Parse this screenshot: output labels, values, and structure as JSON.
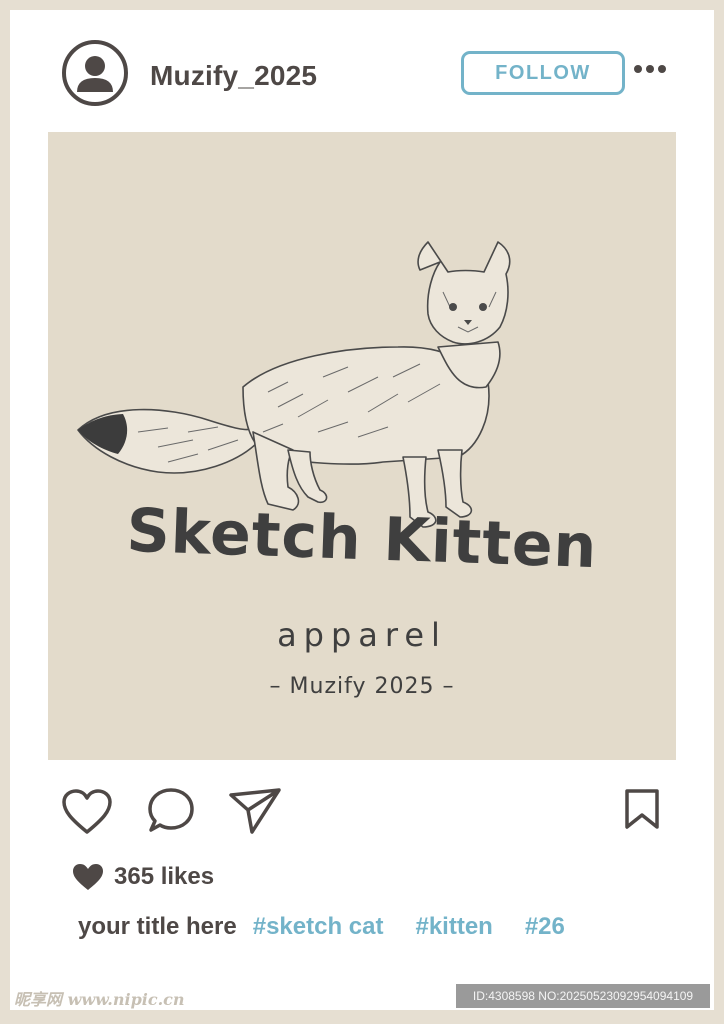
{
  "post": {
    "username": "Muzify_2025",
    "follow_label": "FOLLOW",
    "image": {
      "title": "Sketch Kitten",
      "subtitle": "apparel",
      "credit": "– Muzify 2025 –"
    },
    "likes_text": "365 likes",
    "caption_title": "your title here",
    "hashtags": [
      "#sketch cat",
      "#kitten",
      "#26"
    ]
  },
  "footer": {
    "watermark": "昵享网 www.nipic.cn",
    "id_text": "ID:4308598 NO:20250523092954094109"
  },
  "colors": {
    "page_border": "#e6dfd2",
    "card": "#ffffff",
    "image_bg": "#e3dbcb",
    "icon_dark": "#4e4846",
    "accent": "#73b3c9"
  },
  "icons": [
    "user-avatar-icon",
    "more-icon",
    "heart-icon",
    "comment-icon",
    "send-icon",
    "bookmark-icon",
    "small-heart-icon"
  ]
}
